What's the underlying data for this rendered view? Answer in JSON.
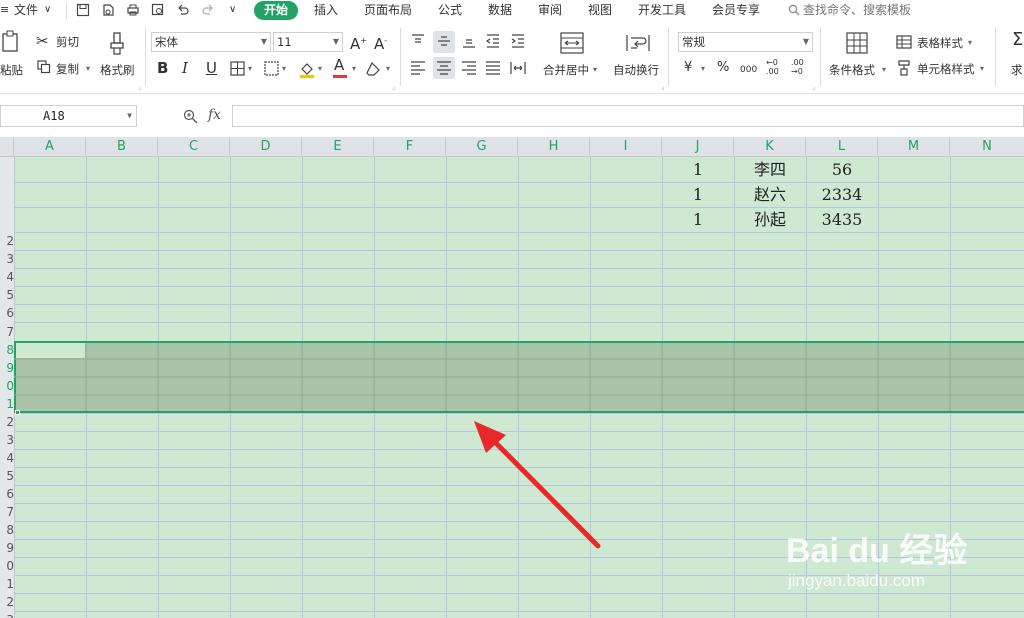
{
  "menubar": {
    "file": "文件",
    "tabs": [
      "开始",
      "插入",
      "页面布局",
      "公式",
      "数据",
      "审阅",
      "视图",
      "开发工具",
      "会员专享"
    ],
    "search_placeholder": "查找命令、搜索模板",
    "accent": "#21a366"
  },
  "ribbon": {
    "cut": "剪切",
    "paste": "粘贴",
    "copy": "复制",
    "format_painter": "格式刷",
    "font_name": "宋体",
    "font_size": "11",
    "merge_center": "合并居中",
    "wrap_text": "自动换行",
    "number_format": "常规",
    "currency_symbol": "¥",
    "percent_symbol": "%",
    "comma_symbol": "000",
    "conditional_format": "条件格式",
    "table_style": "表格样式",
    "cell_style": "单元格样式",
    "sum_partial": "求"
  },
  "formula_bar": {
    "cell_ref": "A18",
    "fx": "fx",
    "value": ""
  },
  "sheet": {
    "columns": [
      "A",
      "B",
      "C",
      "D",
      "E",
      "F",
      "G",
      "H",
      "I",
      "J",
      "K",
      "L",
      "M",
      "N"
    ],
    "row_numbers": [
      "",
      "",
      "",
      "2",
      "3",
      "4",
      "5",
      "6",
      "7",
      "8",
      "9",
      "0",
      "1",
      "2",
      "3",
      "4",
      "5",
      "6",
      "7",
      "8",
      "9",
      "0",
      "1",
      "2",
      "3"
    ],
    "data_rows": [
      {
        "j": "1",
        "k": "李四",
        "l": "56"
      },
      {
        "j": "1",
        "k": "赵六",
        "l": "2334"
      },
      {
        "j": "1",
        "k": "孙起",
        "l": "3435"
      }
    ],
    "selection_color": "#21a366",
    "sheet_color": "#cfe8d2"
  },
  "watermark": {
    "brand": "Bai du 经验",
    "url": "jingyan.baidu.com"
  }
}
